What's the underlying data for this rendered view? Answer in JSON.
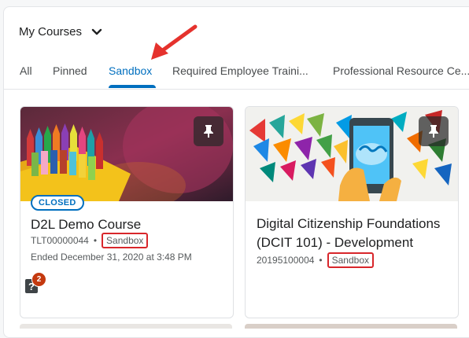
{
  "widget": {
    "title": "My Courses"
  },
  "tabs": [
    {
      "label": "All",
      "active": false
    },
    {
      "label": "Pinned",
      "active": false
    },
    {
      "label": "Sandbox",
      "active": true
    },
    {
      "label": "Required Employee Traini...",
      "active": false
    },
    {
      "label": "Professional Resource Ce...",
      "active": false
    }
  ],
  "courses": [
    {
      "status": "CLOSED",
      "title": "D2L Demo Course",
      "code": "TLT00000044",
      "semester": "Sandbox",
      "ended": "Ended December 31, 2020 at 3:48 PM",
      "notification_count": "2",
      "pin_icon": "pin-icon"
    },
    {
      "title": "Digital Citizenship Foundations (DCIT 101) - Development",
      "code": "20195100004",
      "semester": "Sandbox",
      "pin_icon": "pin-icon"
    }
  ],
  "colors": {
    "accent": "#006fbf",
    "highlight": "#d8262b",
    "badge": "#c4390f"
  }
}
